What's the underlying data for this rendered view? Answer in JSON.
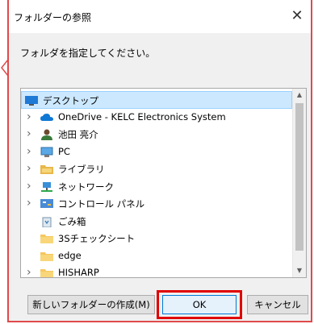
{
  "dialog": {
    "title": "フォルダーの参照",
    "instruction": "フォルダを指定してください。"
  },
  "tree": {
    "items": [
      {
        "label": "デスクトップ",
        "icon": "desktop-icon",
        "expandable": false,
        "selected": true,
        "level": 0
      },
      {
        "label": "OneDrive - KELC Electronics System",
        "icon": "onedrive-cloud-icon",
        "expandable": true,
        "selected": false,
        "level": 1
      },
      {
        "label": "池田 亮介",
        "icon": "user-icon",
        "expandable": true,
        "selected": false,
        "level": 1
      },
      {
        "label": "PC",
        "icon": "pc-icon",
        "expandable": true,
        "selected": false,
        "level": 1
      },
      {
        "label": "ライブラリ",
        "icon": "library-folder-icon",
        "expandable": true,
        "selected": false,
        "level": 1
      },
      {
        "label": "ネットワーク",
        "icon": "network-icon",
        "expandable": true,
        "selected": false,
        "level": 1
      },
      {
        "label": "コントロール パネル",
        "icon": "control-panel-icon",
        "expandable": true,
        "selected": false,
        "level": 1
      },
      {
        "label": "ごみ箱",
        "icon": "recycle-bin-icon",
        "expandable": false,
        "selected": false,
        "level": 1
      },
      {
        "label": "3Sチェックシート",
        "icon": "folder-icon",
        "expandable": false,
        "selected": false,
        "level": 1
      },
      {
        "label": "edge",
        "icon": "folder-icon",
        "expandable": false,
        "selected": false,
        "level": 1
      },
      {
        "label": "HISHARP",
        "icon": "folder-icon",
        "expandable": true,
        "selected": false,
        "level": 1
      }
    ]
  },
  "buttons": {
    "new_folder": "新しいフォルダーの作成(M)",
    "ok": "OK",
    "cancel": "キャンセル"
  },
  "colors": {
    "highlight_border": "#e00000",
    "selected_row": "#cce8ff",
    "frame_border": "#e04a4a"
  }
}
